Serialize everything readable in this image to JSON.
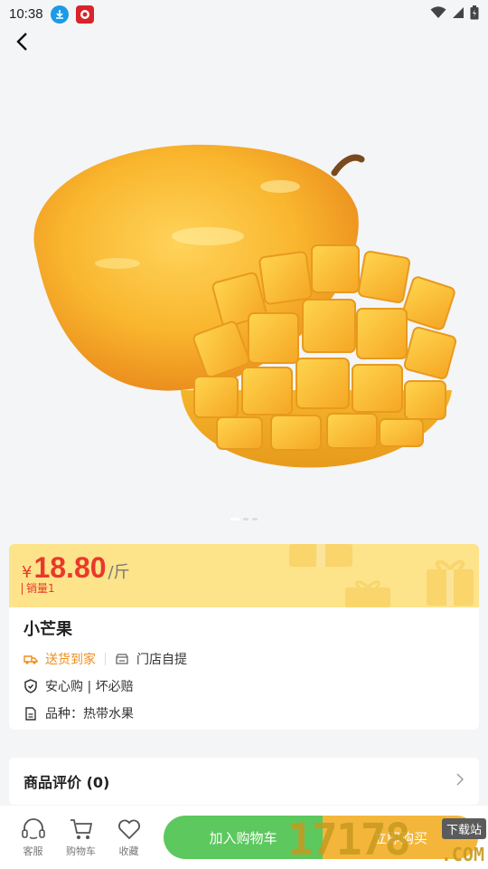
{
  "status": {
    "time": "10:38"
  },
  "product": {
    "currency": "¥",
    "price": "18.80",
    "unit": "/斤",
    "sales": "销量1",
    "title": "小芒果",
    "delivery": "送货到家",
    "pickup": "门店自提",
    "guarantee": "安心购 | 坏必赔",
    "variety": "品种：热带水果"
  },
  "review": {
    "title": "商品评价 (0)"
  },
  "bottom": {
    "service": "客服",
    "cart": "购物车",
    "favorite": "收藏",
    "add_to_cart": "加入购物车",
    "buy_now": "立即购买"
  },
  "watermark": {
    "brand": "17178",
    "tag": "下载站",
    "domain": ".COM"
  },
  "colors": {
    "price_red": "#e8392c",
    "band_yellow": "#fde38a",
    "cart_green": "#5cc85d",
    "buy_orange": "#f4b63a"
  },
  "icons": [
    "download-icon",
    "app-icon",
    "wifi-icon",
    "signal-icon",
    "battery-icon",
    "back-icon",
    "delivery-icon",
    "store-icon",
    "shield-icon",
    "document-icon",
    "chevron-right-icon",
    "headset-icon",
    "cart-icon",
    "heart-icon"
  ]
}
